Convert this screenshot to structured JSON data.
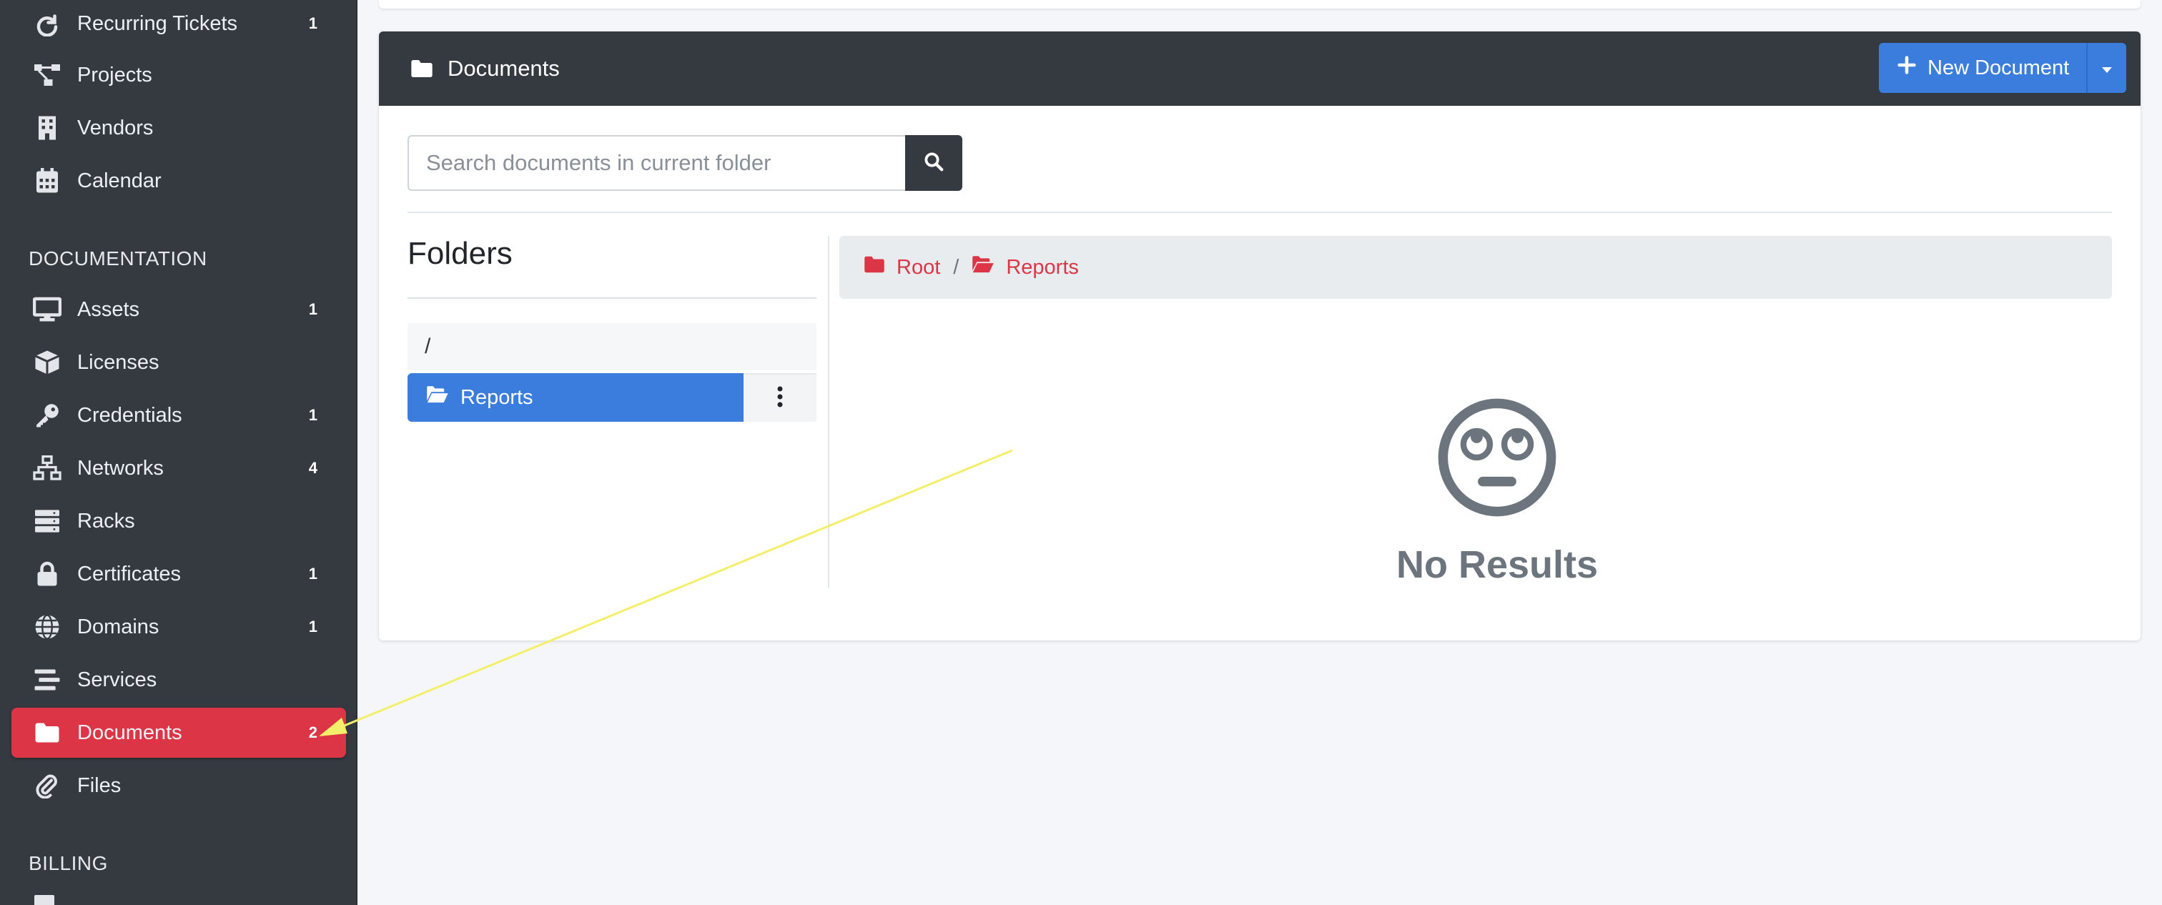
{
  "sidebar": {
    "items_top": [
      {
        "label": "Recurring Tickets",
        "count": "1",
        "icon": "redo-icon"
      },
      {
        "label": "Projects",
        "count": "",
        "icon": "project-diagram-icon"
      },
      {
        "label": "Vendors",
        "count": "",
        "icon": "building-icon"
      },
      {
        "label": "Calendar",
        "count": "",
        "icon": "calendar-icon"
      }
    ],
    "documentation_header": "DOCUMENTATION",
    "doc_items": [
      {
        "label": "Assets",
        "count": "1",
        "icon": "desktop-icon"
      },
      {
        "label": "Licenses",
        "count": "",
        "icon": "cube-icon"
      },
      {
        "label": "Credentials",
        "count": "1",
        "icon": "key-icon"
      },
      {
        "label": "Networks",
        "count": "4",
        "icon": "network-icon"
      },
      {
        "label": "Racks",
        "count": "",
        "icon": "server-icon"
      },
      {
        "label": "Certificates",
        "count": "1",
        "icon": "lock-icon"
      },
      {
        "label": "Domains",
        "count": "1",
        "icon": "globe-icon"
      },
      {
        "label": "Services",
        "count": "",
        "icon": "stream-icon"
      },
      {
        "label": "Documents",
        "count": "2",
        "icon": "folder-icon",
        "active": true
      },
      {
        "label": "Files",
        "count": "",
        "icon": "paperclip-icon"
      }
    ],
    "billing_header": "BILLING"
  },
  "card": {
    "title": "Documents",
    "new_button_label": "New Document"
  },
  "search": {
    "placeholder": "Search documents in current folder"
  },
  "folders": {
    "title": "Folders",
    "root_label": "/",
    "items": [
      {
        "label": "Reports",
        "selected": true
      }
    ]
  },
  "breadcrumb": {
    "root": "Root",
    "separator": "/",
    "current": "Reports"
  },
  "empty_state": {
    "text": "No Results"
  },
  "colors": {
    "sidebar_bg": "#343a40",
    "active_red": "#dc3545",
    "primary_blue": "#3b7ddd",
    "annotation_arrow": "#f4ef6a"
  }
}
